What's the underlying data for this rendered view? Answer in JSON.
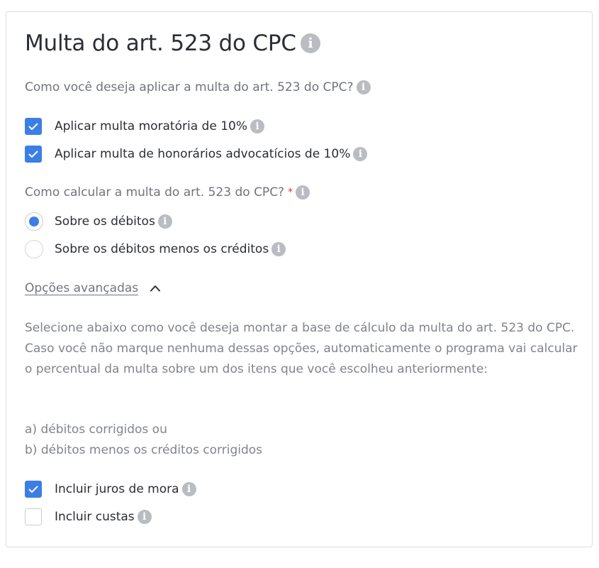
{
  "title": "Multa do art. 523 do CPC",
  "apply_question": "Como você deseja aplicar a multa do art. 523 do CPC?",
  "apply_options": [
    {
      "label": "Aplicar multa moratória de 10%",
      "checked": true
    },
    {
      "label": "Aplicar multa de honorários advocatícios de 10%",
      "checked": true
    }
  ],
  "calc_question": "Como calcular a multa do art. 523 do CPC?",
  "required_marker": "*",
  "calc_options": [
    {
      "label": "Sobre os débitos",
      "selected": true
    },
    {
      "label": "Sobre os débitos menos os créditos",
      "selected": false
    }
  ],
  "advanced_label": "Opções avançadas",
  "advanced_description": "Selecione abaixo como você deseja montar a base de cálculo da multa do art. 523 do CPC. Caso você não marque nenhuma dessas opções, automaticamente o programa vai calcular o percentual da multa sobre um dos itens que você escolheu anteriormente:",
  "advanced_items": [
    "a) débitos corrigidos ou",
    "b) débitos menos os créditos corrigidos"
  ],
  "advanced_options": [
    {
      "label": "Incluir juros de mora",
      "checked": true
    },
    {
      "label": "Incluir custas",
      "checked": false
    }
  ],
  "info_glyph": "i",
  "colors": {
    "accent": "#3b7ee6",
    "required": "#e03131",
    "info_icon": "#b9bcc1"
  }
}
